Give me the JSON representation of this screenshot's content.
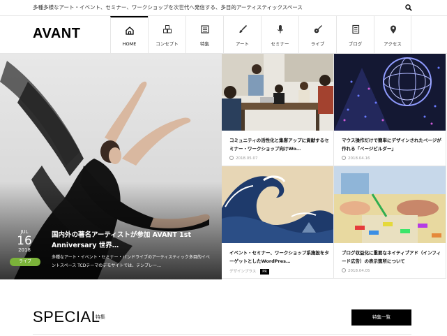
{
  "topbar": {
    "tagline": "多種多様なアート・イベント、セミナー、ワークショップを次世代へ発信する、多目的アーティスティックスペース",
    "search_icon": "search-icon"
  },
  "header": {
    "logo": "AVANT",
    "nav": [
      {
        "label": "HOME",
        "icon": "home-icon",
        "active": true
      },
      {
        "label": "コンセプト",
        "icon": "cubes-icon"
      },
      {
        "label": "特集",
        "icon": "newspaper-icon"
      },
      {
        "label": "アート",
        "icon": "brush-icon"
      },
      {
        "label": "セミナー",
        "icon": "microphone-icon"
      },
      {
        "label": "ライブ",
        "icon": "guitar-icon"
      },
      {
        "label": "ブログ",
        "icon": "document-icon"
      },
      {
        "label": "アクセス",
        "icon": "map-pin-icon"
      }
    ]
  },
  "hero": {
    "month": "JUL",
    "day": "16",
    "year": "2018",
    "category": "ライブ",
    "title": "国内外の著名アーティストが参加 AVANT 1st Anniversary 世界…",
    "excerpt": "多種なアート・イベント・セミナー・バンドライブのアーティスティック多目的イベントスペース TCDテーマのデモサイトでは、テンプレー…"
  },
  "cards": [
    {
      "title": "コミュニティの活性化と集客アップに貢献するセミナー・ワークショップ向けWo…",
      "date": "2018.05.07",
      "author": "",
      "pr": ""
    },
    {
      "title": "マウス操作だけで簡単にデザインされたページが作れる「ページビルダー」",
      "date": "2018.04.16",
      "author": "",
      "pr": ""
    },
    {
      "title": "イベント・セミナー、ワークショップ系施設をターゲットとしたWordPres…",
      "date": "",
      "author": "デザインプラス",
      "pr": "PR"
    },
    {
      "title": "ブログ収益化に重要なネイティブアド（インフィード広告）の表示箇所について",
      "date": "2018.04.05",
      "author": "",
      "pr": ""
    }
  ],
  "special": {
    "heading": "SPECIAL",
    "sub": "特集",
    "button": "特集一覧"
  }
}
